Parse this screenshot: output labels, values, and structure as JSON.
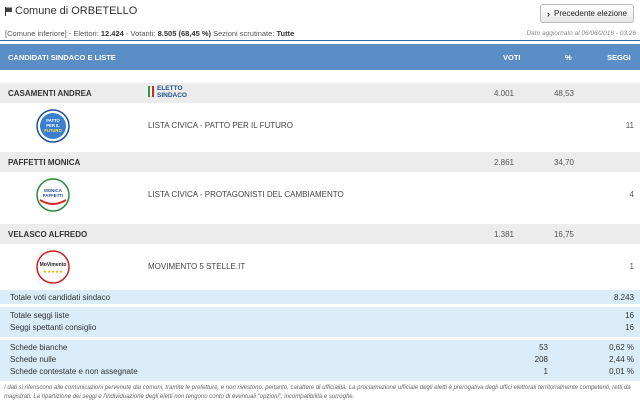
{
  "title": "Comune di ORBETELLO",
  "prev_button": "Precedente elezione",
  "info": {
    "prefix": "[Comune inferiore] - Elettori: ",
    "electors": "12.424",
    "voters_label": " - Votanti: ",
    "voters": "8.505",
    "voters_pct": " (68,45 %)",
    "sections_label": " Sezioni scrutinate: ",
    "sections": "Tutte"
  },
  "updated": "Dato aggiornato al 06/06/2016 - 03:26",
  "header": {
    "candidates": "CANDIDATI SINDACO E LISTE",
    "votes": "VOTI",
    "percent": "%",
    "seats": "SEGGI"
  },
  "candidates": [
    {
      "name": "CASAMENTI ANDREA",
      "votes": "4.001",
      "pct": "48,53",
      "elected": "ELETTO",
      "elected_sub": "SINDACO",
      "list": {
        "name": "LISTA CIVICA - PATTO PER IL FUTURO",
        "seats": "11",
        "logo_icon": "patto-per-il-futuro-logo",
        "logo_text": [
          "PATTO",
          "PER IL",
          "FUTURO"
        ]
      }
    },
    {
      "name": "PAFFETTI MONICA",
      "votes": "2.861",
      "pct": "34,70",
      "list": {
        "name": "LISTA CIVICA - PROTAGONISTI DEL CAMBIAMENTO",
        "seats": "4",
        "logo_icon": "monica-paffetti-logo",
        "logo_text": [
          "MONICA",
          "PAFFETTI"
        ]
      }
    },
    {
      "name": "VELASCO ALFREDO",
      "votes": "1.381",
      "pct": "16,75",
      "list": {
        "name": "MOVIMENTO 5 STELLE.IT",
        "seats": "1",
        "logo_icon": "movimento-5-stelle-logo",
        "logo_text": [
          "MoVimento"
        ]
      }
    }
  ],
  "totals": {
    "total_votes_label": "Totale voti candidati sindaco",
    "total_votes": "8.243",
    "list_seats_label": "Totale seggi liste",
    "list_seats": "16",
    "council_seats_label": "Seggi spettanti consiglio",
    "council_seats": "16",
    "blank_label": "Schede bianche",
    "blank_count": "53",
    "blank_pct": "0,62 %",
    "null_label": "Schede nulle",
    "null_count": "208",
    "null_pct": "2,44 %",
    "contested_label": "Schede contestate e non assegnate",
    "contested_count": "1",
    "contested_pct": "0,01 %"
  },
  "footnote": "I dati si riferiscono alle comunicazioni pervenute dai comuni, tramite le prefetture, e non rivestono, pertanto, carattere di ufficialità. La proclamazione ufficiale degli eletti è prerogativa degli uffici elettorali territorialmente competenti, retti da magistrati. La ripartizione dei seggi e l'individuazione degli eletti non tengono conto di eventuali \"opzioni\", incompatibilità e surroghe.",
  "colors": {
    "header_bg": "#5b8ec6",
    "summary_bg": "#d9ecf7",
    "candidate_bg": "#ececec",
    "accent": "#2e6ca4"
  }
}
